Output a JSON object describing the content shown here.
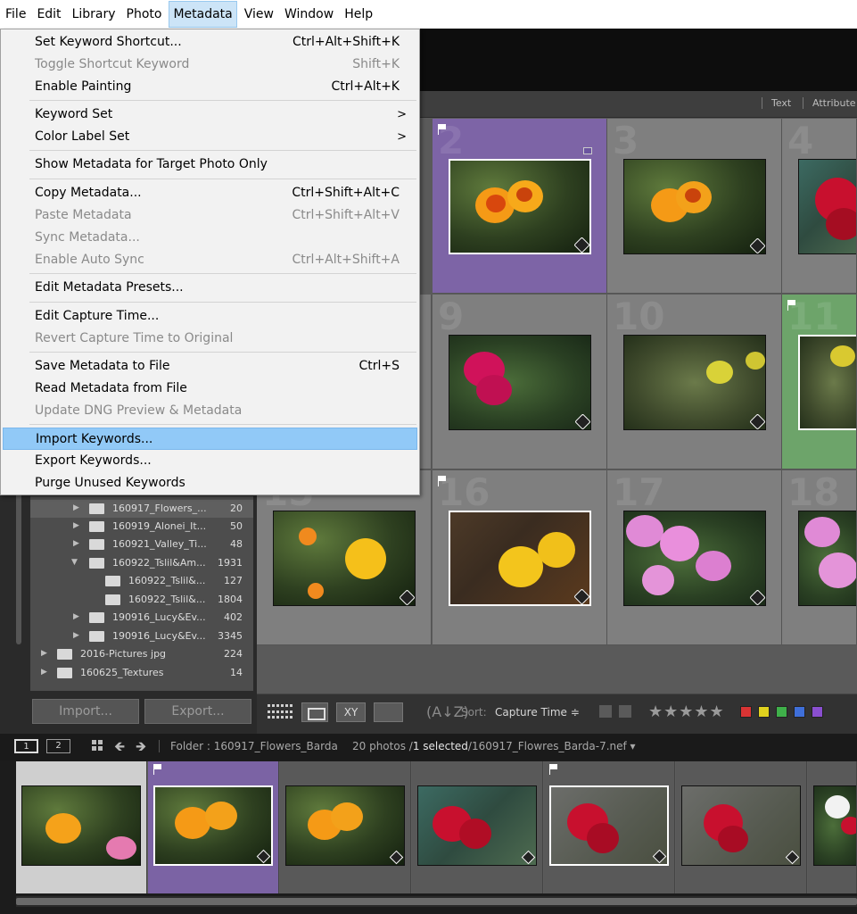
{
  "menubar": {
    "items": [
      "File",
      "Edit",
      "Library",
      "Photo",
      "Metadata",
      "View",
      "Window",
      "Help"
    ],
    "active_index": 4
  },
  "metadata_menu": {
    "items": [
      {
        "label": "Set Keyword Shortcut...",
        "shortcut": "Ctrl+Alt+Shift+K",
        "disabled": false
      },
      {
        "label": "Toggle Shortcut Keyword",
        "shortcut": "Shift+K",
        "disabled": true
      },
      {
        "label": "Enable Painting",
        "shortcut": "Ctrl+Alt+K",
        "disabled": false
      },
      {
        "label": "Keyword Set",
        "submenu": ">",
        "disabled": false
      },
      {
        "label": "Color Label Set",
        "submenu": ">",
        "disabled": false
      },
      {
        "label": "Show Metadata for Target Photo Only",
        "disabled": false
      },
      {
        "label": "Copy Metadata...",
        "shortcut": "Ctrl+Shift+Alt+C",
        "disabled": false
      },
      {
        "label": "Paste Metadata",
        "shortcut": "Ctrl+Shift+Alt+V",
        "disabled": true
      },
      {
        "label": "Sync Metadata...",
        "disabled": true
      },
      {
        "label": "Enable Auto Sync",
        "shortcut": "Ctrl+Alt+Shift+A",
        "disabled": true
      },
      {
        "label": "Edit Metadata Presets...",
        "disabled": false
      },
      {
        "label": "Edit Capture Time...",
        "disabled": false
      },
      {
        "label": "Revert Capture Time to Original",
        "disabled": true
      },
      {
        "label": "Save Metadata to File",
        "shortcut": "Ctrl+S",
        "disabled": false
      },
      {
        "label": "Read Metadata from File",
        "disabled": false
      },
      {
        "label": "Update DNG Preview & Metadata",
        "disabled": true
      },
      {
        "label": "Import Keywords...",
        "disabled": false,
        "highlighted": true
      },
      {
        "label": "Export Keywords...",
        "disabled": false
      },
      {
        "label": "Purge Unused Keywords",
        "disabled": false
      }
    ]
  },
  "grid_header": {
    "text": "Text",
    "attribute": "Attribute"
  },
  "grid": {
    "cells": [
      {
        "number": "2",
        "flagged": true,
        "selected": true,
        "color_label": "purple"
      },
      {
        "number": "3"
      },
      {
        "number": "4"
      },
      {
        "number": "9"
      },
      {
        "number": "10"
      },
      {
        "number": "11",
        "flagged": true,
        "label_green": true
      },
      {
        "number": "15"
      },
      {
        "number": "16",
        "flagged": true
      },
      {
        "number": "17"
      },
      {
        "number": "18"
      }
    ]
  },
  "folders": [
    {
      "name": "160917_Flowers_...",
      "count": "20",
      "expanded": true,
      "indent": 1,
      "selected": true
    },
    {
      "name": "160919_Alonei_It...",
      "count": "50",
      "indent": 1
    },
    {
      "name": "160921_Valley_Ti...",
      "count": "48",
      "indent": 1
    },
    {
      "name": "160922_Tslil&Am...",
      "count": "1931",
      "indent": 1,
      "expanded": true
    },
    {
      "name": "160922_Tslil&...",
      "count": "127",
      "indent": 2
    },
    {
      "name": "160922_Tslil&...",
      "count": "1804",
      "indent": 2
    },
    {
      "name": "190916_Lucy&Ev...",
      "count": "402",
      "indent": 1
    },
    {
      "name": "190916_Lucy&Ev...",
      "count": "3345",
      "indent": 1
    },
    {
      "name": "2016-Pictures jpg",
      "count": "224",
      "indent": 0
    },
    {
      "name": "160625_Textures",
      "count": "14",
      "indent": 0
    }
  ],
  "left_buttons": {
    "import": "Import...",
    "export": "Export..."
  },
  "toolbar": {
    "sort_label": "Sort:",
    "sort_value": "Capture Time",
    "sort_arrow": "≑",
    "az_icon": "(A↓Z)",
    "xy_label": "XY",
    "stars": "★★★★★",
    "color_labels": [
      "#d93434",
      "#e0d21e",
      "#3fb04a",
      "#3f6fd9",
      "#8a4fd0"
    ]
  },
  "filmstrip_header": {
    "screen1": "1",
    "screen2": "2",
    "folder_path": "Folder : 160917_Flowers_Barda",
    "count_prefix": "20 photos /",
    "count_selected": "1 selected",
    "count_suffix": "/160917_Flowres_Barda-7.nef ▾"
  }
}
